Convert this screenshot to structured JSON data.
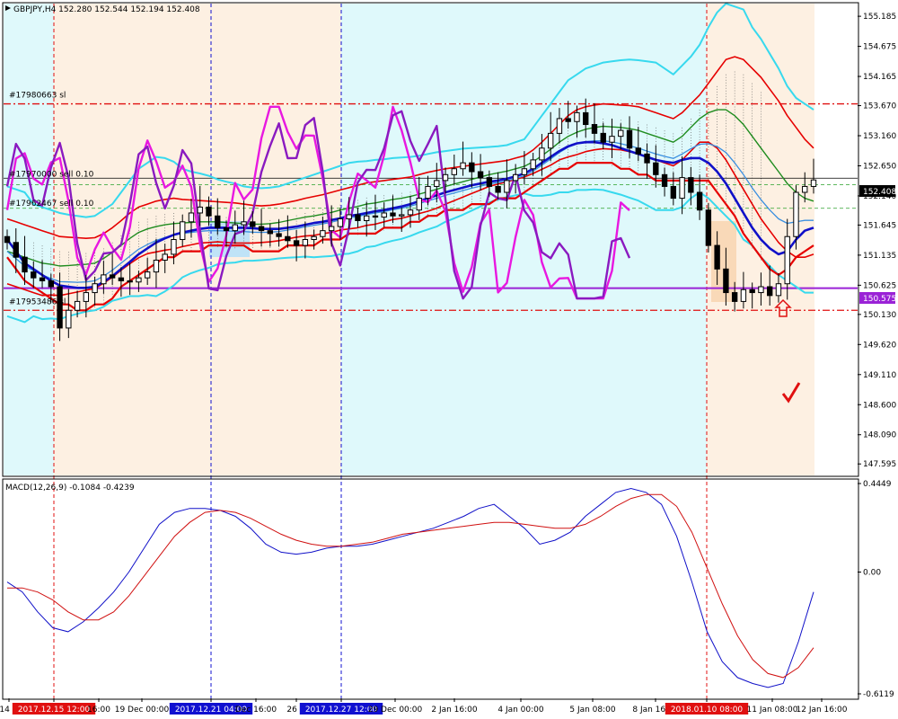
{
  "header": {
    "symbol_info": "GBPJPY,H4  152.280 152.544 152.194 152.408",
    "macd_info": "MACD(12,26,9) -0.1084 -0.4239"
  },
  "colors": {
    "background": "#ffffff",
    "cyan_zone": "#dff9fb",
    "peach_zone": "#fdf0e2",
    "bb_outer": "#37d9ee",
    "bb_middle_red": "#e60000",
    "bb_inner_green": "#1f8c1f",
    "ma_blue": "#1010c8",
    "ma_lightblue": "#3a8fe0",
    "osc_magenta": "#e818e0",
    "osc_purple": "#8a1ac0",
    "level_purple": "#9a22d6",
    "macd_main": "#1010c8",
    "macd_signal": "#d01010",
    "tag_red": "#e01010",
    "tag_blue": "#1010d0",
    "price_tag": "#000000"
  },
  "chart_data": [
    {
      "type": "candlestick",
      "title": "GBPJPY,H4",
      "ohlc_last": {
        "open": 152.28,
        "high": 152.544,
        "low": 152.194,
        "close": 152.408
      },
      "ylim": [
        147.4,
        155.4
      ],
      "y_ticks": [
        "155.185",
        "154.675",
        "154.165",
        "153.670",
        "153.160",
        "152.650",
        "152.140",
        "151.645",
        "151.135",
        "150.625",
        "150.130",
        "149.620",
        "149.110",
        "148.600",
        "148.090",
        "147.595"
      ],
      "x_ticks": [
        "14 D",
        "2017.12.15 12:00",
        "16:00",
        "19 Dec 00:00",
        "2017.12.21 04:00",
        "Dec 16:00",
        "26 D",
        "2017.12.27 12:00",
        "29 Dec 00:00",
        "2 Jan 16:00",
        "4 Jan 00:00",
        "5 Jan 08:00",
        "8 Jan 16:00",
        "2018.01.10 08:00",
        "11 Jan 08:00",
        "12 Jan 16:00"
      ],
      "price_tags": {
        "current": "152.408",
        "purple_level": "150.575"
      },
      "levels": {
        "purple_level": 150.575,
        "red_dashdot_top": 153.7,
        "red_dashdot_bottom": 150.2,
        "green_dash_1": 152.33,
        "green_dash_2": 151.93,
        "black_order_line": 152.44
      },
      "order_labels": [
        {
          "text": "#17980663 sl",
          "price": 153.78
        },
        {
          "text": "#17970000 sell 0.10",
          "price": 152.44
        },
        {
          "text": "#17962467 sell 0.10",
          "price": 151.94
        },
        {
          "text": "#17953486 sl",
          "price": 150.27
        }
      ],
      "series": [
        {
          "name": "close",
          "values": [
            151.35,
            151.1,
            150.85,
            150.75,
            150.7,
            150.6,
            149.9,
            150.2,
            150.35,
            150.5,
            150.65,
            150.8,
            150.75,
            150.7,
            150.68,
            150.75,
            150.85,
            151.05,
            151.15,
            151.4,
            151.7,
            151.85,
            151.95,
            151.8,
            151.6,
            151.55,
            151.65,
            151.7,
            151.62,
            151.55,
            151.5,
            151.45,
            151.38,
            151.3,
            151.4,
            151.45,
            151.55,
            151.62,
            151.75,
            151.82,
            151.72,
            151.8,
            151.78,
            151.85,
            151.8,
            151.82,
            151.9,
            152.1,
            152.3,
            152.4,
            152.5,
            152.6,
            152.7,
            152.55,
            152.45,
            152.3,
            152.2,
            152.4,
            152.5,
            152.6,
            152.75,
            152.95,
            153.2,
            153.45,
            153.4,
            153.55,
            153.35,
            153.2,
            153.05,
            153.15,
            153.25,
            152.95,
            152.85,
            152.7,
            152.5,
            152.3,
            152.1,
            152.45,
            152.2,
            151.9,
            151.3,
            150.9,
            150.5,
            150.35,
            150.55,
            150.5,
            150.6,
            150.45,
            150.65,
            151.45,
            152.2,
            152.3,
            152.41
          ]
        },
        {
          "name": "bb_upper_outer",
          "values": [
            152.3,
            152.25,
            152.2,
            152.0,
            151.95,
            151.9,
            151.85,
            151.82,
            151.8,
            151.78,
            151.8,
            151.9,
            152.0,
            152.2,
            152.4,
            152.6,
            152.7,
            152.8,
            152.78,
            152.72,
            152.6,
            152.55,
            152.52,
            152.48,
            152.42,
            152.38,
            152.35,
            152.3,
            152.28,
            152.27,
            152.28,
            152.3,
            152.35,
            152.4,
            152.45,
            152.5,
            152.55,
            152.6,
            152.65,
            152.7,
            152.72,
            152.73,
            152.75,
            152.76,
            152.78,
            152.79,
            152.8,
            152.82,
            152.85,
            152.88,
            152.9,
            152.92,
            152.94,
            152.95,
            152.96,
            152.97,
            152.98,
            153.0,
            153.05,
            153.1,
            153.3,
            153.5,
            153.7,
            153.9,
            154.1,
            154.2,
            154.3,
            154.35,
            154.4,
            154.42,
            154.44,
            154.45,
            154.44,
            154.42,
            154.4,
            154.3,
            154.2,
            154.35,
            154.5,
            154.7,
            155.0,
            155.25,
            155.4,
            155.35,
            155.3,
            155.0,
            154.8,
            154.55,
            154.3,
            154.0,
            153.8,
            153.7,
            153.6
          ]
        },
        {
          "name": "bb_upper_red",
          "values": [
            151.75,
            151.7,
            151.65,
            151.6,
            151.55,
            151.5,
            151.45,
            151.44,
            151.43,
            151.42,
            151.43,
            151.5,
            151.6,
            151.72,
            151.85,
            151.95,
            152.0,
            152.05,
            152.08,
            152.1,
            152.08,
            152.07,
            152.06,
            152.05,
            152.04,
            152.03,
            152.02,
            152.0,
            151.98,
            151.97,
            151.98,
            152.0,
            152.03,
            152.06,
            152.1,
            152.13,
            152.16,
            152.2,
            152.24,
            152.28,
            152.32,
            152.36,
            152.38,
            152.4,
            152.42,
            152.44,
            152.46,
            152.5,
            152.54,
            152.57,
            152.6,
            152.62,
            152.64,
            152.66,
            152.68,
            152.7,
            152.72,
            152.74,
            152.78,
            152.82,
            152.92,
            153.05,
            153.2,
            153.35,
            153.5,
            153.6,
            153.65,
            153.68,
            153.7,
            153.69,
            153.68,
            153.67,
            153.65,
            153.6,
            153.55,
            153.5,
            153.45,
            153.55,
            153.7,
            153.85,
            154.05,
            154.25,
            154.45,
            154.5,
            154.45,
            154.3,
            154.15,
            153.95,
            153.75,
            153.5,
            153.3,
            153.1,
            152.95
          ]
        },
        {
          "name": "bb_middle_green",
          "values": [
            151.2,
            151.15,
            151.1,
            151.05,
            151.0,
            150.98,
            150.95,
            150.96,
            150.97,
            150.98,
            151.0,
            151.08,
            151.18,
            151.3,
            151.42,
            151.52,
            151.58,
            151.62,
            151.65,
            151.67,
            151.68,
            151.69,
            151.7,
            151.7,
            151.7,
            151.69,
            151.68,
            151.67,
            151.66,
            151.66,
            151.67,
            151.69,
            151.72,
            151.75,
            151.78,
            151.8,
            151.83,
            151.86,
            151.9,
            151.93,
            151.96,
            152.0,
            152.02,
            152.05,
            152.08,
            152.1,
            152.13,
            152.17,
            152.21,
            152.25,
            152.3,
            152.34,
            152.38,
            152.42,
            152.46,
            152.5,
            152.53,
            152.56,
            152.6,
            152.64,
            152.72,
            152.82,
            152.93,
            153.05,
            153.15,
            153.22,
            153.27,
            153.3,
            153.32,
            153.31,
            153.3,
            153.28,
            153.25,
            153.2,
            153.15,
            153.1,
            153.05,
            153.15,
            153.3,
            153.45,
            153.55,
            153.6,
            153.6,
            153.5,
            153.35,
            153.15,
            152.95,
            152.75,
            152.55,
            152.35,
            152.2,
            152.1,
            152.05
          ]
        },
        {
          "name": "ma_blue",
          "values": [
            151.4,
            151.2,
            151.0,
            150.9,
            150.8,
            150.7,
            150.62,
            150.6,
            150.58,
            150.58,
            150.6,
            150.68,
            150.78,
            150.9,
            151.02,
            151.15,
            151.25,
            151.35,
            151.42,
            151.48,
            151.52,
            151.55,
            151.58,
            151.6,
            151.6,
            151.6,
            151.6,
            151.6,
            151.59,
            151.58,
            151.58,
            151.58,
            151.6,
            151.62,
            151.65,
            151.68,
            151.7,
            151.73,
            151.76,
            151.8,
            151.82,
            151.85,
            151.88,
            151.9,
            151.93,
            151.96,
            152.0,
            152.05,
            152.1,
            152.15,
            152.2,
            152.24,
            152.28,
            152.32,
            152.35,
            152.38,
            152.4,
            152.43,
            152.47,
            152.52,
            152.6,
            152.7,
            152.8,
            152.9,
            152.98,
            153.03,
            153.05,
            153.05,
            153.03,
            153.0,
            152.95,
            152.9,
            152.85,
            152.8,
            152.75,
            152.72,
            152.7,
            152.75,
            152.78,
            152.78,
            152.7,
            152.55,
            152.35,
            152.1,
            151.85,
            151.6,
            151.4,
            151.25,
            151.15,
            151.2,
            151.4,
            151.55,
            151.6
          ]
        }
      ]
    },
    {
      "type": "line",
      "title": "MACD(12,26,9)",
      "ylim": [
        -0.6119,
        0.4449
      ],
      "y_ticks": [
        "0.4449",
        "0.00",
        "-0.6119"
      ],
      "series": [
        {
          "name": "MACD",
          "values": [
            -0.05,
            -0.1,
            -0.2,
            -0.28,
            -0.3,
            -0.25,
            -0.18,
            -0.1,
            0.0,
            0.12,
            0.24,
            0.3,
            0.32,
            0.32,
            0.31,
            0.28,
            0.22,
            0.14,
            0.1,
            0.09,
            0.1,
            0.12,
            0.13,
            0.13,
            0.14,
            0.16,
            0.18,
            0.2,
            0.22,
            0.25,
            0.28,
            0.32,
            0.34,
            0.28,
            0.22,
            0.14,
            0.16,
            0.2,
            0.28,
            0.34,
            0.4,
            0.42,
            0.4,
            0.34,
            0.18,
            -0.05,
            -0.3,
            -0.45,
            -0.53,
            -0.56,
            -0.58,
            -0.56,
            -0.35,
            -0.1
          ]
        },
        {
          "name": "Signal",
          "values": [
            -0.08,
            -0.08,
            -0.1,
            -0.14,
            -0.2,
            -0.24,
            -0.24,
            -0.2,
            -0.12,
            -0.02,
            0.08,
            0.18,
            0.25,
            0.3,
            0.31,
            0.3,
            0.27,
            0.23,
            0.19,
            0.16,
            0.14,
            0.13,
            0.13,
            0.14,
            0.15,
            0.17,
            0.19,
            0.2,
            0.21,
            0.22,
            0.23,
            0.24,
            0.25,
            0.25,
            0.24,
            0.23,
            0.22,
            0.22,
            0.24,
            0.28,
            0.33,
            0.37,
            0.39,
            0.39,
            0.33,
            0.2,
            0.02,
            -0.16,
            -0.32,
            -0.44,
            -0.51,
            -0.53,
            -0.48,
            -0.38
          ]
        }
      ]
    }
  ]
}
